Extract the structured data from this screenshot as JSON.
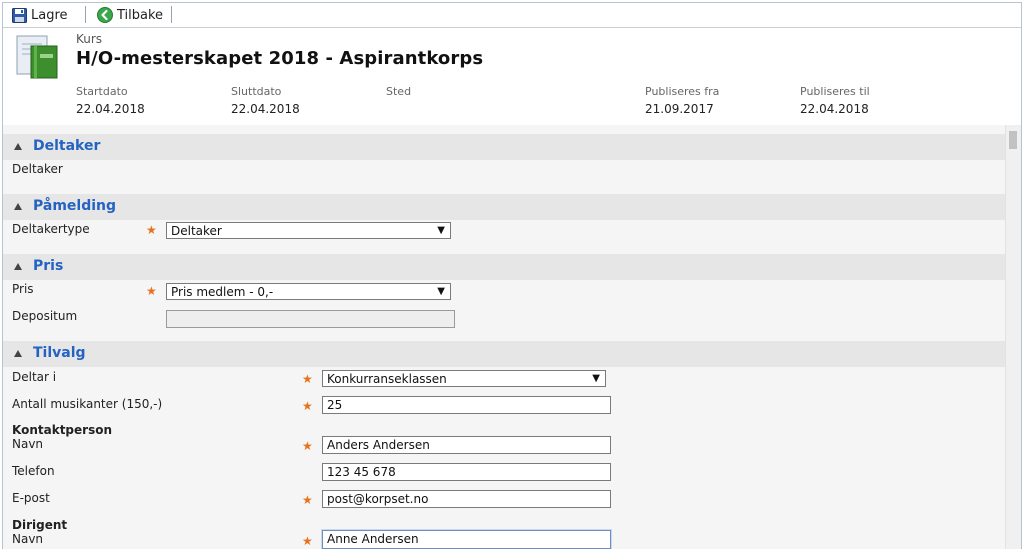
{
  "toolbar": {
    "save_label": "Lagre",
    "back_label": "Tilbake"
  },
  "header": {
    "type_label": "Kurs",
    "title": "H/O-mesterskapet 2018 - Aspirantkorps",
    "meta": {
      "start_label": "Startdato",
      "start_value": "22.04.2018",
      "end_label": "Sluttdato",
      "end_value": "22.04.2018",
      "place_label": "Sted",
      "place_value": "",
      "pub_from_label": "Publiseres fra",
      "pub_from_value": "21.09.2017",
      "pub_to_label": "Publiseres til",
      "pub_to_value": "22.04.2018"
    }
  },
  "sections": {
    "deltaker": {
      "title": "Deltaker",
      "row_label": "Deltaker"
    },
    "pamelding": {
      "title": "Påmelding",
      "type_label": "Deltakertype",
      "type_value": "Deltaker"
    },
    "pris": {
      "title": "Pris",
      "price_label": "Pris",
      "price_value": "Pris medlem - 0,-",
      "deposit_label": "Depositum",
      "deposit_value": ""
    },
    "tilvalg": {
      "title": "Tilvalg",
      "deltar_label": "Deltar i",
      "deltar_value": "Konkurranseklassen",
      "antall_label": "Antall musikanter (150,-)",
      "antall_value": "25",
      "kontakt_heading": "Kontaktperson",
      "kontakt_navn_label": "Navn",
      "kontakt_navn_value": "Anders Andersen",
      "telefon_label": "Telefon",
      "telefon_value": "123 45 678",
      "epost_label": "E-post",
      "epost_value": "post@korpset.no",
      "dirigent_heading": "Dirigent",
      "dirigent_navn_label": "Navn",
      "dirigent_navn_value": "Anne Andersen"
    }
  },
  "required_marker": "★",
  "colors": {
    "section_title": "#2463c2",
    "required_star": "#e8721c",
    "back_icon": "#3aa84a"
  }
}
